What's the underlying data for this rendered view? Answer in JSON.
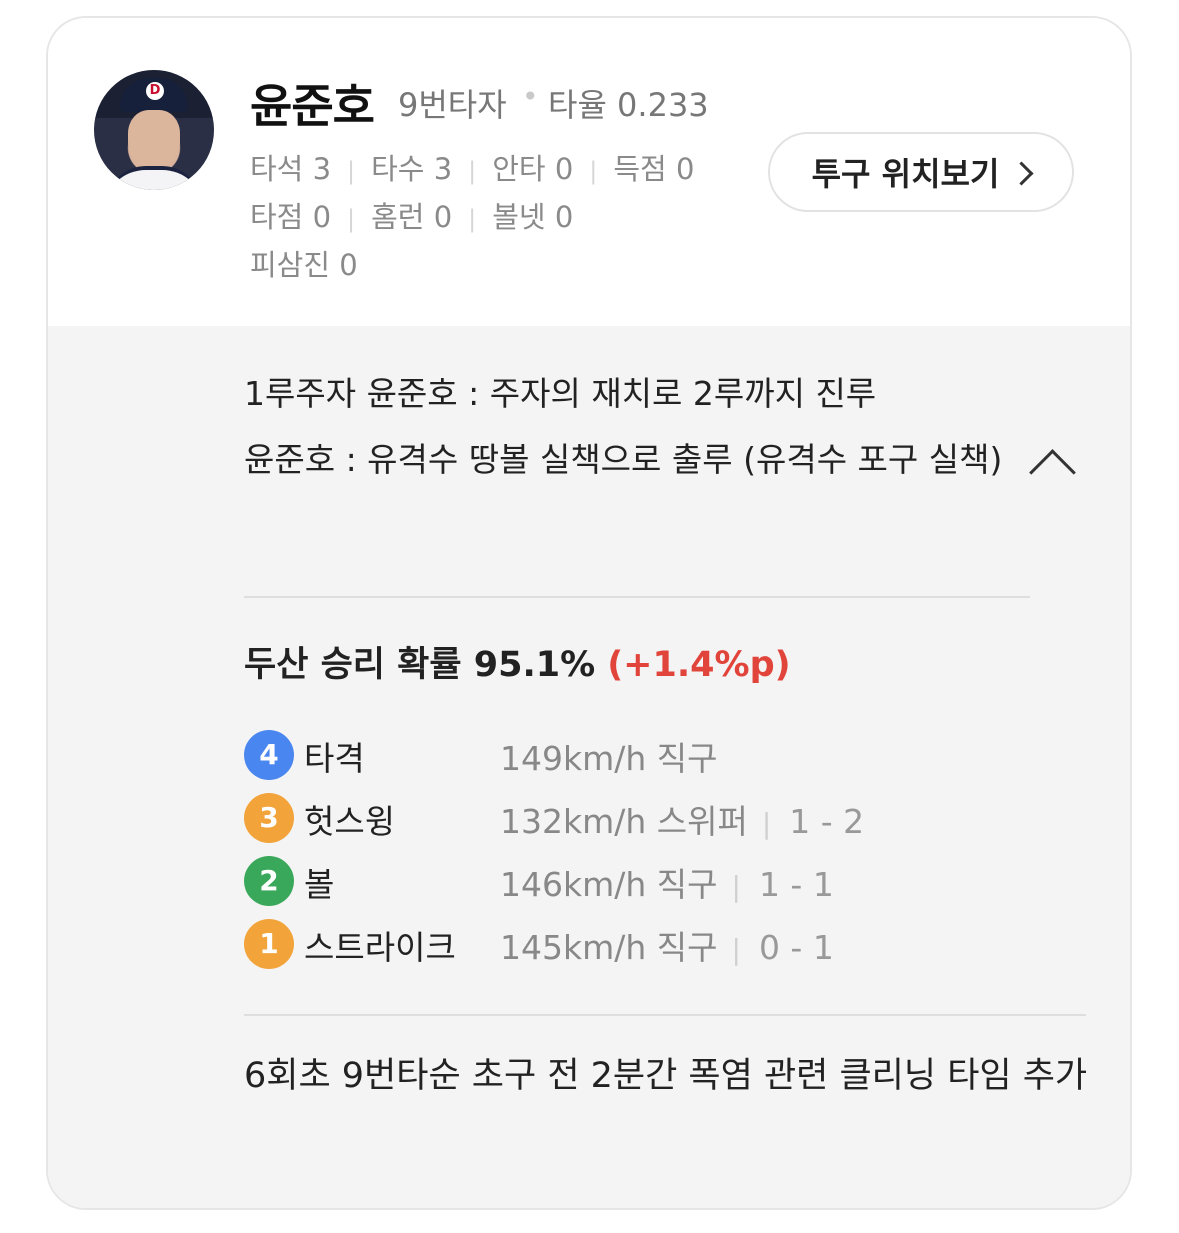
{
  "player": {
    "name": "윤준호",
    "order": "9번타자",
    "avg_label": "타율 0.233",
    "stats_line1": [
      "타석 3",
      "타수 3",
      "안타 0",
      "득점 0"
    ],
    "stats_line2": [
      "타점 0",
      "홈런 0",
      "볼넷 0"
    ],
    "stats_line3": [
      "피삼진 0"
    ]
  },
  "pitch_location_button": "투구 위치보기",
  "plays": [
    "1루주자 윤준호 : 주자의 재치로 2루까지 진루",
    "윤준호 : 유격수 땅볼 실책으로 출루 (유격수 포구 실책)"
  ],
  "win_probability": {
    "text": "두산 승리 확률 95.1%",
    "delta": "(+1.4%p)",
    "delta_color": "#e0443a"
  },
  "pitches": [
    {
      "num": "4",
      "result": "타격",
      "speed": "149km/h 직구",
      "count": "",
      "color": "#4a86f0"
    },
    {
      "num": "3",
      "result": "헛스윙",
      "speed": "132km/h 스위퍼",
      "count": "1 - 2",
      "color": "#f2a33a"
    },
    {
      "num": "2",
      "result": "볼",
      "speed": "146km/h 직구",
      "count": "1 - 1",
      "color": "#3aa85a"
    },
    {
      "num": "1",
      "result": "스트라이크",
      "speed": "145km/h 직구",
      "count": "0 - 1",
      "color": "#f2a33a"
    }
  ],
  "note": "6회초 9번타순 초구 전 2분간 폭염 관련 클리닝 타임 추가"
}
